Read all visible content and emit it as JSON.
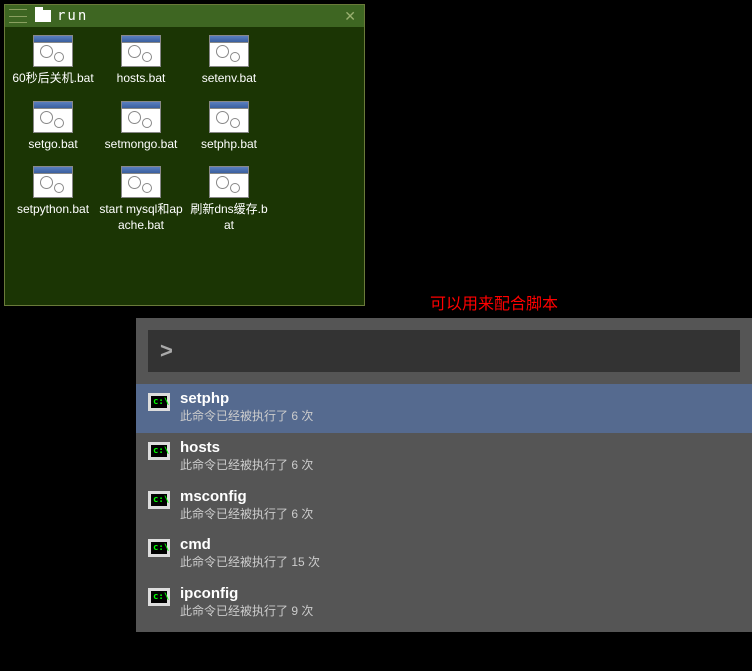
{
  "explorer": {
    "title": "run",
    "files": [
      {
        "name": "60秒后关机.bat"
      },
      {
        "name": "hosts.bat"
      },
      {
        "name": "setenv.bat"
      },
      {
        "name": "setgo.bat"
      },
      {
        "name": "setmongo.bat"
      },
      {
        "name": "setphp.bat"
      },
      {
        "name": "setpython.bat"
      },
      {
        "name": "start mysql和apache.bat"
      },
      {
        "name": "刷新dns缓存.bat"
      }
    ]
  },
  "annotation": "可以用来配合脚本",
  "launcher": {
    "prompt": ">",
    "results": [
      {
        "title": "setphp",
        "sub": "此命令已经被执行了 6 次",
        "selected": true
      },
      {
        "title": "hosts",
        "sub": "此命令已经被执行了 6 次",
        "selected": false
      },
      {
        "title": "msconfig",
        "sub": "此命令已经被执行了 6 次",
        "selected": false
      },
      {
        "title": "cmd",
        "sub": "此命令已经被执行了 15 次",
        "selected": false
      },
      {
        "title": "ipconfig",
        "sub": "此命令已经被执行了 9 次",
        "selected": false
      }
    ]
  }
}
